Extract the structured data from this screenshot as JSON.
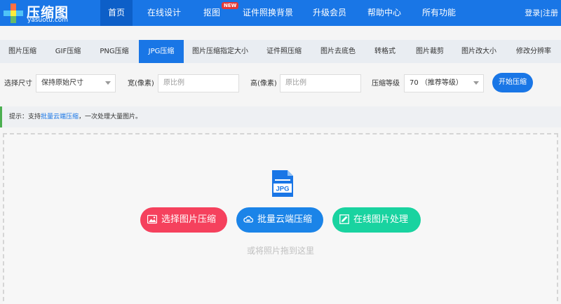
{
  "brand": {
    "title": "压缩图",
    "subtitle": "yasuotu.com",
    "colors": {
      "primary": "#1976e6",
      "active_nav": "#0d5fc8"
    }
  },
  "nav": {
    "items": [
      "首页",
      "在线设计",
      "抠图",
      "证件照换背景",
      "升级会员",
      "帮助中心",
      "所有功能"
    ],
    "active_index": 0,
    "new_badge": "NEW",
    "user": {
      "login": "登录",
      "separator": "|",
      "register": "注册"
    }
  },
  "tabs": {
    "items": [
      "图片压缩",
      "GIF压缩",
      "PNG压缩",
      "JPG压缩",
      "图片压缩指定大小",
      "证件照压缩",
      "图片去底色",
      "转格式",
      "图片裁剪",
      "图片改大小",
      "修改分辨率"
    ],
    "active_index": 3
  },
  "options": {
    "size_label": "选择尺寸",
    "size_value": "保持原始尺寸",
    "width_label": "宽(像素)",
    "width_placeholder": "原比例",
    "height_label": "高(像素)",
    "height_placeholder": "原比例",
    "level_label": "压缩等级",
    "level_value": "70 （推荐等级）",
    "start_button": "开始压缩"
  },
  "tip": {
    "prefix": "提示：支持",
    "link": "批量云端压缩",
    "suffix": "，一次处理大量图片。"
  },
  "dropzone": {
    "file_type": "JPG",
    "buttons": [
      {
        "label": "选择图片压缩",
        "color": "#f5415d",
        "icon": "image-upload-icon"
      },
      {
        "label": "批量云端压缩",
        "color": "#1b84e8",
        "icon": "cloud-icon"
      },
      {
        "label": "在线图片处理",
        "color": "#19d3a0",
        "icon": "edit-image-icon"
      }
    ],
    "hint": "或将照片拖到这里"
  }
}
